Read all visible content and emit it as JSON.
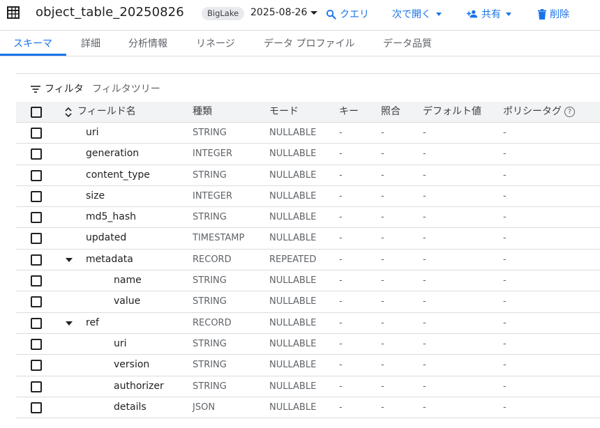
{
  "header": {
    "title": "object_table_20250826",
    "badge": "BigLake",
    "version": "2025-08-26",
    "actions": {
      "query": "クエリ",
      "open_in": "次で開く",
      "share": "共有",
      "delete": "削除"
    }
  },
  "tabs": [
    "スキーマ",
    "詳細",
    "分析情報",
    "リネージ",
    "データ プロファイル",
    "データ品質"
  ],
  "filter": {
    "label": "フィルタ",
    "tree": "フィルタツリー"
  },
  "columns": {
    "field": "フィールド名",
    "type": "種類",
    "mode": "モード",
    "key": "キー",
    "collation": "照合",
    "default": "デフォルト値",
    "policy": "ポリシータグ",
    "help": "?"
  },
  "rows": [
    {
      "name": "uri",
      "type": "STRING",
      "mode": "NULLABLE",
      "key": "-",
      "collation": "-",
      "default": "-",
      "policy": "-",
      "level": 0,
      "expandable": false
    },
    {
      "name": "generation",
      "type": "INTEGER",
      "mode": "NULLABLE",
      "key": "-",
      "collation": "-",
      "default": "-",
      "policy": "-",
      "level": 0,
      "expandable": false
    },
    {
      "name": "content_type",
      "type": "STRING",
      "mode": "NULLABLE",
      "key": "-",
      "collation": "-",
      "default": "-",
      "policy": "-",
      "level": 0,
      "expandable": false
    },
    {
      "name": "size",
      "type": "INTEGER",
      "mode": "NULLABLE",
      "key": "-",
      "collation": "-",
      "default": "-",
      "policy": "-",
      "level": 0,
      "expandable": false
    },
    {
      "name": "md5_hash",
      "type": "STRING",
      "mode": "NULLABLE",
      "key": "-",
      "collation": "-",
      "default": "-",
      "policy": "-",
      "level": 0,
      "expandable": false
    },
    {
      "name": "updated",
      "type": "TIMESTAMP",
      "mode": "NULLABLE",
      "key": "-",
      "collation": "-",
      "default": "-",
      "policy": "-",
      "level": 0,
      "expandable": false
    },
    {
      "name": "metadata",
      "type": "RECORD",
      "mode": "REPEATED",
      "key": "-",
      "collation": "-",
      "default": "-",
      "policy": "-",
      "level": 0,
      "expandable": true
    },
    {
      "name": "name",
      "type": "STRING",
      "mode": "NULLABLE",
      "key": "-",
      "collation": "-",
      "default": "-",
      "policy": "-",
      "level": 1,
      "expandable": false
    },
    {
      "name": "value",
      "type": "STRING",
      "mode": "NULLABLE",
      "key": "-",
      "collation": "-",
      "default": "-",
      "policy": "-",
      "level": 1,
      "expandable": false
    },
    {
      "name": "ref",
      "type": "RECORD",
      "mode": "NULLABLE",
      "key": "-",
      "collation": "-",
      "default": "-",
      "policy": "-",
      "level": 0,
      "expandable": true
    },
    {
      "name": "uri",
      "type": "STRING",
      "mode": "NULLABLE",
      "key": "-",
      "collation": "-",
      "default": "-",
      "policy": "-",
      "level": 1,
      "expandable": false
    },
    {
      "name": "version",
      "type": "STRING",
      "mode": "NULLABLE",
      "key": "-",
      "collation": "-",
      "default": "-",
      "policy": "-",
      "level": 1,
      "expandable": false
    },
    {
      "name": "authorizer",
      "type": "STRING",
      "mode": "NULLABLE",
      "key": "-",
      "collation": "-",
      "default": "-",
      "policy": "-",
      "level": 1,
      "expandable": false
    },
    {
      "name": "details",
      "type": "JSON",
      "mode": "NULLABLE",
      "key": "-",
      "collation": "-",
      "default": "-",
      "policy": "-",
      "level": 1,
      "expandable": false
    }
  ],
  "colors": {
    "accent": "#1a73e8",
    "header_bg": "#f1f3f4",
    "border": "#dadce0"
  }
}
